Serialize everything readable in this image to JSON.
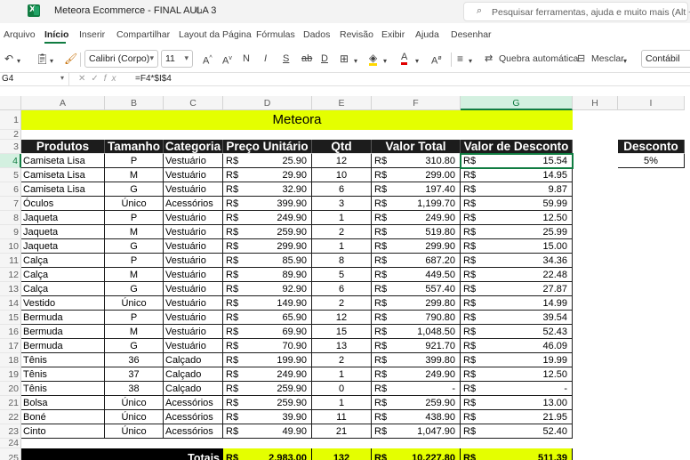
{
  "titlebar": {
    "app_icon": "excel-icon",
    "doc_title": "Meteora Ecommerce - FINAL AULA 3",
    "sync_icon": "cloud-sync-icon",
    "search_placeholder": "Pesquisar ferramentas, ajuda e muito mais (Alt + G)"
  },
  "tabs": [
    "Arquivo",
    "Início",
    "Inserir",
    "Compartilhar",
    "Layout da Página",
    "Fórmulas",
    "Dados",
    "Revisão",
    "Exibir",
    "Ajuda",
    "Desenhar"
  ],
  "active_tab": "Início",
  "toolbar": {
    "font_name": "Calibri (Corpo)",
    "font_size": "11",
    "bold": "N",
    "italic": "I",
    "underline": "S",
    "wrap_text": "Quebra automática",
    "merge": "Mesclar",
    "number_format": "Contábil"
  },
  "formula_bar": {
    "name_box": "G4",
    "formula": "=F4*$I$4"
  },
  "columns": [
    "A",
    "B",
    "C",
    "D",
    "E",
    "F",
    "G",
    "H",
    "I"
  ],
  "rows": [
    "1",
    "2",
    "3",
    "4",
    "5",
    "6",
    "7",
    "8",
    "9",
    "10",
    "11",
    "12",
    "13",
    "14",
    "15",
    "16",
    "17",
    "18",
    "19",
    "20",
    "21",
    "22",
    "23",
    "24",
    "25"
  ],
  "sheet": {
    "title": "Meteora",
    "headers": [
      "Produtos",
      "Tamanho",
      "Categoria",
      "Preço Unitário",
      "Qtd",
      "Valor Total",
      "Valor de Desconto"
    ],
    "currency": "R$",
    "data": [
      [
        "Camiseta Lisa",
        "P",
        "Vestuário",
        "25.90",
        "12",
        "310.80",
        "15.54"
      ],
      [
        "Camiseta Lisa",
        "M",
        "Vestuário",
        "29.90",
        "10",
        "299.00",
        "14.95"
      ],
      [
        "Camiseta Lisa",
        "G",
        "Vestuário",
        "32.90",
        "6",
        "197.40",
        "9.87"
      ],
      [
        "Óculos",
        "Único",
        "Acessórios",
        "399.90",
        "3",
        "1,199.70",
        "59.99"
      ],
      [
        "Jaqueta",
        "P",
        "Vestuário",
        "249.90",
        "1",
        "249.90",
        "12.50"
      ],
      [
        "Jaqueta",
        "M",
        "Vestuário",
        "259.90",
        "2",
        "519.80",
        "25.99"
      ],
      [
        "Jaqueta",
        "G",
        "Vestuário",
        "299.90",
        "1",
        "299.90",
        "15.00"
      ],
      [
        "Calça",
        "P",
        "Vestuário",
        "85.90",
        "8",
        "687.20",
        "34.36"
      ],
      [
        "Calça",
        "M",
        "Vestuário",
        "89.90",
        "5",
        "449.50",
        "22.48"
      ],
      [
        "Calça",
        "G",
        "Vestuário",
        "92.90",
        "6",
        "557.40",
        "27.87"
      ],
      [
        "Vestido",
        "Único",
        "Vestuário",
        "149.90",
        "2",
        "299.80",
        "14.99"
      ],
      [
        "Bermuda",
        "P",
        "Vestuário",
        "65.90",
        "12",
        "790.80",
        "39.54"
      ],
      [
        "Bermuda",
        "M",
        "Vestuário",
        "69.90",
        "15",
        "1,048.50",
        "52.43"
      ],
      [
        "Bermuda",
        "G",
        "Vestuário",
        "70.90",
        "13",
        "921.70",
        "46.09"
      ],
      [
        "Tênis",
        "36",
        "Calçado",
        "199.90",
        "2",
        "399.80",
        "19.99"
      ],
      [
        "Tênis",
        "37",
        "Calçado",
        "249.90",
        "1",
        "249.90",
        "12.50"
      ],
      [
        "Tênis",
        "38",
        "Calçado",
        "259.90",
        "0",
        "-",
        "-"
      ],
      [
        "Bolsa",
        "Único",
        "Acessórios",
        "259.90",
        "1",
        "259.90",
        "13.00"
      ],
      [
        "Boné",
        "Único",
        "Acessórios",
        "39.90",
        "11",
        "438.90",
        "21.95"
      ],
      [
        "Cinto",
        "Único",
        "Acessórios",
        "49.90",
        "21",
        "1,047.90",
        "52.40"
      ]
    ],
    "totals_label": "Totais",
    "totals": {
      "price": "2,983.00",
      "qty": "132",
      "total": "10,227.80",
      "discount": "511.39"
    },
    "discount_header": "Desconto",
    "discount_value": "5%"
  },
  "selected_cell": "G4"
}
